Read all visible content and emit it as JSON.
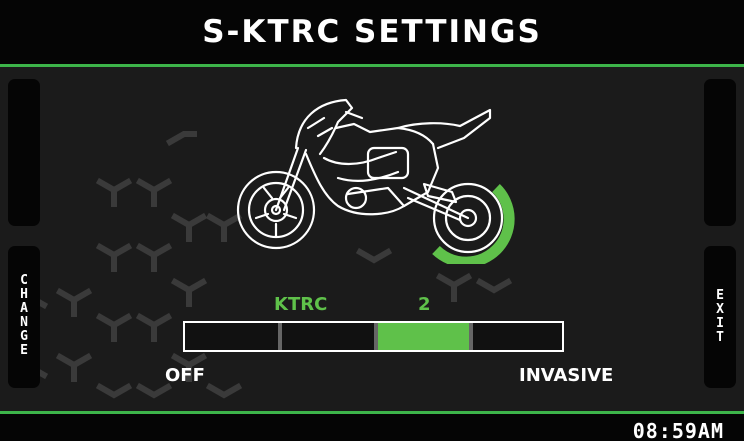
{
  "header": {
    "title": "S-KTRC SETTINGS"
  },
  "left_tab": {
    "label": "C\nH\nA\nN\nG\nE"
  },
  "right_tab": {
    "label": "E\nX\nI\nT"
  },
  "ktrc": {
    "label": "KTRC",
    "value": "2",
    "level": 2,
    "levels": 4,
    "min_label": "OFF",
    "max_label": "INVASIVE"
  },
  "footer": {
    "time": "08:59AM"
  },
  "colors": {
    "accent": "#3db54a",
    "active_segment": "#5fc14a"
  },
  "icons": {
    "bike": "motorcycle-outline-icon",
    "rear_wheel_indicator": "traction-arc-icon"
  }
}
